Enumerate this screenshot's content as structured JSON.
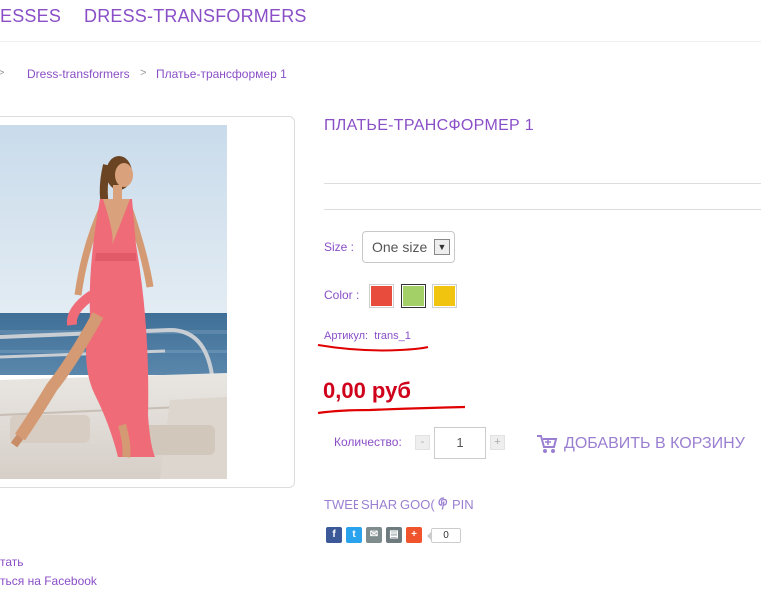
{
  "nav": {
    "items": [
      {
        "label": "ESSES"
      },
      {
        "label": "DRESS-TRANSFORMERS"
      }
    ]
  },
  "breadcrumb": {
    "items": [
      {
        "label": "Dress-transformers"
      },
      {
        "label": "Платье-трансформер 1"
      }
    ],
    "separator": ">"
  },
  "product": {
    "title": "ПЛАТЬЕ-ТРАНСФОРМЕР 1",
    "size_label": "Size :",
    "size_value": "One size",
    "color_label": "Color :",
    "colors": [
      "#e74c3c",
      "#a3d168",
      "#f1c40f"
    ],
    "selected_color_index": 1,
    "sku_label": "Артикул:",
    "sku_value": "trans_1",
    "price": "0,00 руб",
    "quantity_label": "Количество:",
    "quantity_value": "1",
    "qty_minus": "-",
    "qty_plus": "+",
    "add_to_cart": "ДОБАВИТЬ В КОРЗИНУ"
  },
  "left_links": {
    "print": "тать",
    "facebook": "ться на Facebook"
  },
  "social": {
    "tweet": "TWEE",
    "share": "SHAR",
    "google": "GOO(",
    "pin": "PIN",
    "share_count": "0"
  },
  "colors": {
    "accent": "#8a4fc7",
    "price": "#d0021b",
    "annotation": "#e00000"
  }
}
